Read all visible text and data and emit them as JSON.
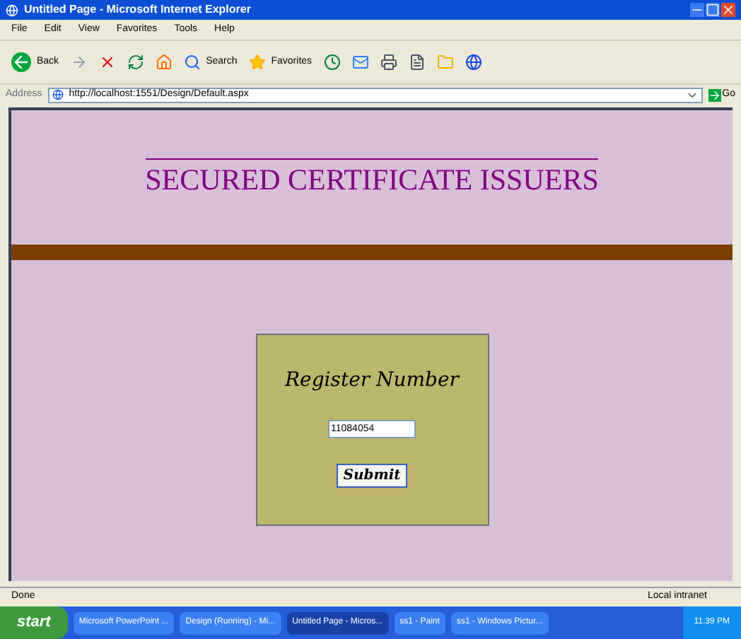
{
  "window": {
    "title": "Untitled Page - Microsoft Internet Explorer"
  },
  "menu": [
    "File",
    "Edit",
    "View",
    "Favorites",
    "Tools",
    "Help"
  ],
  "toolbar": {
    "back": "Back",
    "search": "Search",
    "favorites": "Favorites"
  },
  "address": {
    "label": "Address",
    "value": "http://localhost:1551/Design/Default.aspx",
    "go": "Go"
  },
  "page": {
    "heading": "SECURED CERTIFICATE ISSUERS",
    "form": {
      "label": "Register Number",
      "value": "11084054",
      "submit": "Submit"
    }
  },
  "status_bar": {
    "text": "Done",
    "zone": "Local intranet"
  },
  "taskbar": {
    "start": "start",
    "clock": "11:39 PM",
    "items": [
      {
        "label": "Microsoft PowerPoint ...",
        "selected": false
      },
      {
        "label": "Design (Running) - Mi...",
        "selected": false
      },
      {
        "label": "Untitled Page - Micros...",
        "selected": true
      },
      {
        "label": "ss1 - Paint",
        "selected": false
      },
      {
        "label": "ss1 - Windows Pictur...",
        "selected": false
      }
    ]
  }
}
